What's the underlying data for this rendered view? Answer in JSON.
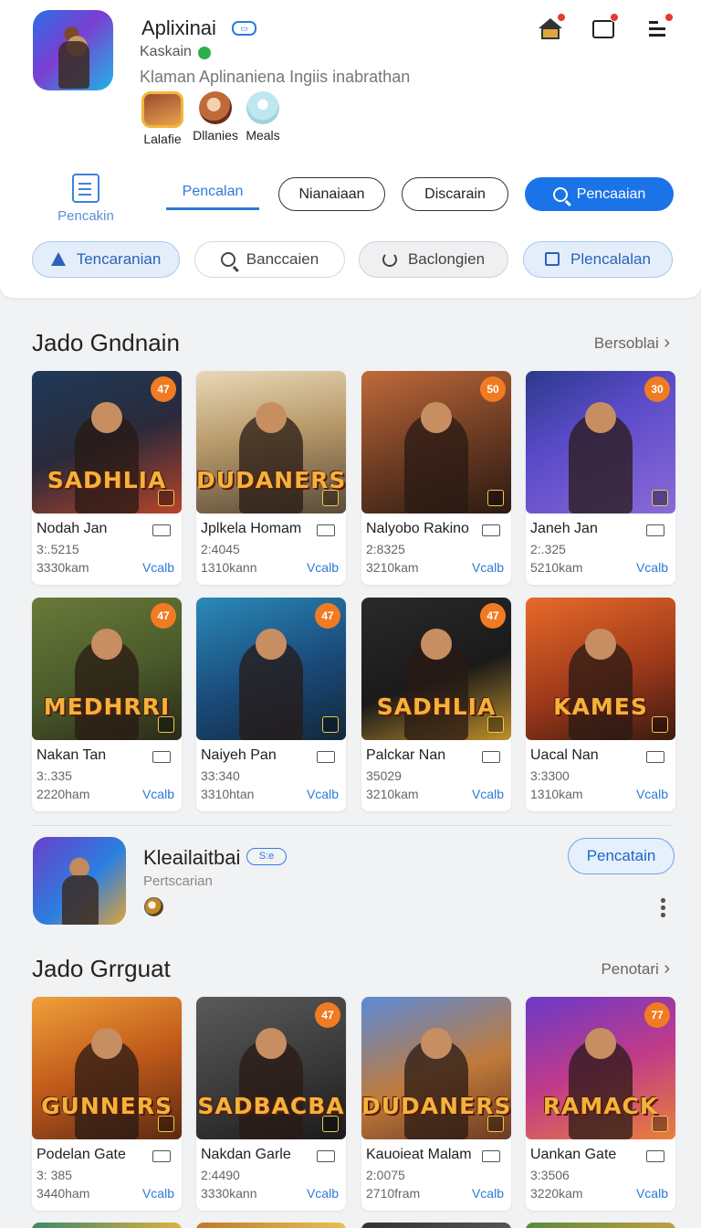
{
  "header": {
    "app_name": "Aplixinai",
    "developer": "Kaskain",
    "tagline": "Klaman Aplinaniena Ingiis inabrathan",
    "mini_items": [
      {
        "label": "Lalafie"
      },
      {
        "label": "Dllanies"
      },
      {
        "label": "Meals"
      }
    ],
    "icons": [
      "home-icon",
      "calendar-icon",
      "menu-icon"
    ],
    "notification_color": "#e53935"
  },
  "filters": {
    "side_label": "Pencakin",
    "tab_active": "Pencalan",
    "pills": [
      "Nianaiaan",
      "Discarain"
    ],
    "primary_button": "Pencaaian",
    "chips": [
      "Tencaranian",
      "Banccaien",
      "Baclongien",
      "Plencalalan"
    ]
  },
  "section1": {
    "title": "Jado Gndnain",
    "link": "Bersoblai",
    "cards": [
      {
        "name": "Nodah Jan",
        "line2": "3:.5215",
        "line3": "3330kam",
        "action": "Vcalb",
        "badge": "47",
        "art_title": "SADHLIA"
      },
      {
        "name": "Jplkela Homam",
        "line2": "2:4045",
        "line3": "1310kann",
        "action": "Vcalb",
        "badge": "",
        "art_title": "DUDANERS"
      },
      {
        "name": "Nalyobo Rakino",
        "line2": "2:8325",
        "line3": "3210kam",
        "action": "Vcalb",
        "badge": "50",
        "art_title": ""
      },
      {
        "name": "Janeh Jan",
        "line2": "2:.325",
        "line3": "5210kam",
        "action": "Vcalb",
        "badge": "30",
        "art_title": ""
      },
      {
        "name": "Nakan Tan",
        "line2": "3:.335",
        "line3": "2220ham",
        "action": "Vcalb",
        "badge": "47",
        "art_title": "MEDHRRI"
      },
      {
        "name": "Naiyeh Pan",
        "line2": "33:340",
        "line3": "3310htan",
        "action": "Vcalb",
        "badge": "47",
        "art_title": ""
      },
      {
        "name": "Palckar Nan",
        "line2": "35029",
        "line3": "3210kam",
        "action": "Vcalb",
        "badge": "47",
        "art_title": "SADHLIA"
      },
      {
        "name": "Uacal Nan",
        "line2": "3:3300",
        "line3": "1310kam",
        "action": "Vcalb",
        "badge": "",
        "art_title": "KAMES"
      }
    ]
  },
  "featured": {
    "name": "Kleailaitbai",
    "badge": "S:e",
    "subtitle": "Pertscarian",
    "button": "Pencatain"
  },
  "section2": {
    "title": "Jado Grrguat",
    "link": "Penotari",
    "cards": [
      {
        "name": "Podelan Gate",
        "line2": "3: 385",
        "line3": "3440ham",
        "action": "Vcalb",
        "badge": "",
        "art_title": "GUNNERS"
      },
      {
        "name": "Nakdan Garle",
        "line2": "2:4490",
        "line3": "3330kann",
        "action": "Vcalb",
        "badge": "47",
        "art_title": "SADBACBA"
      },
      {
        "name": "Kauoieat Malam",
        "line2": "2:0075",
        "line3": "2710fram",
        "action": "Vcalb",
        "badge": "",
        "art_title": "DUDANERS"
      },
      {
        "name": "Uankan Gate",
        "line2": "3:3506",
        "line3": "3220kam",
        "action": "Vcalb",
        "badge": "77",
        "art_title": "RAMACK"
      }
    ]
  },
  "colors": {
    "accent": "#1b73e8",
    "link_blue": "#2d7ad8",
    "badge_orange": "#f07b22",
    "background": "#f1f2f4"
  }
}
